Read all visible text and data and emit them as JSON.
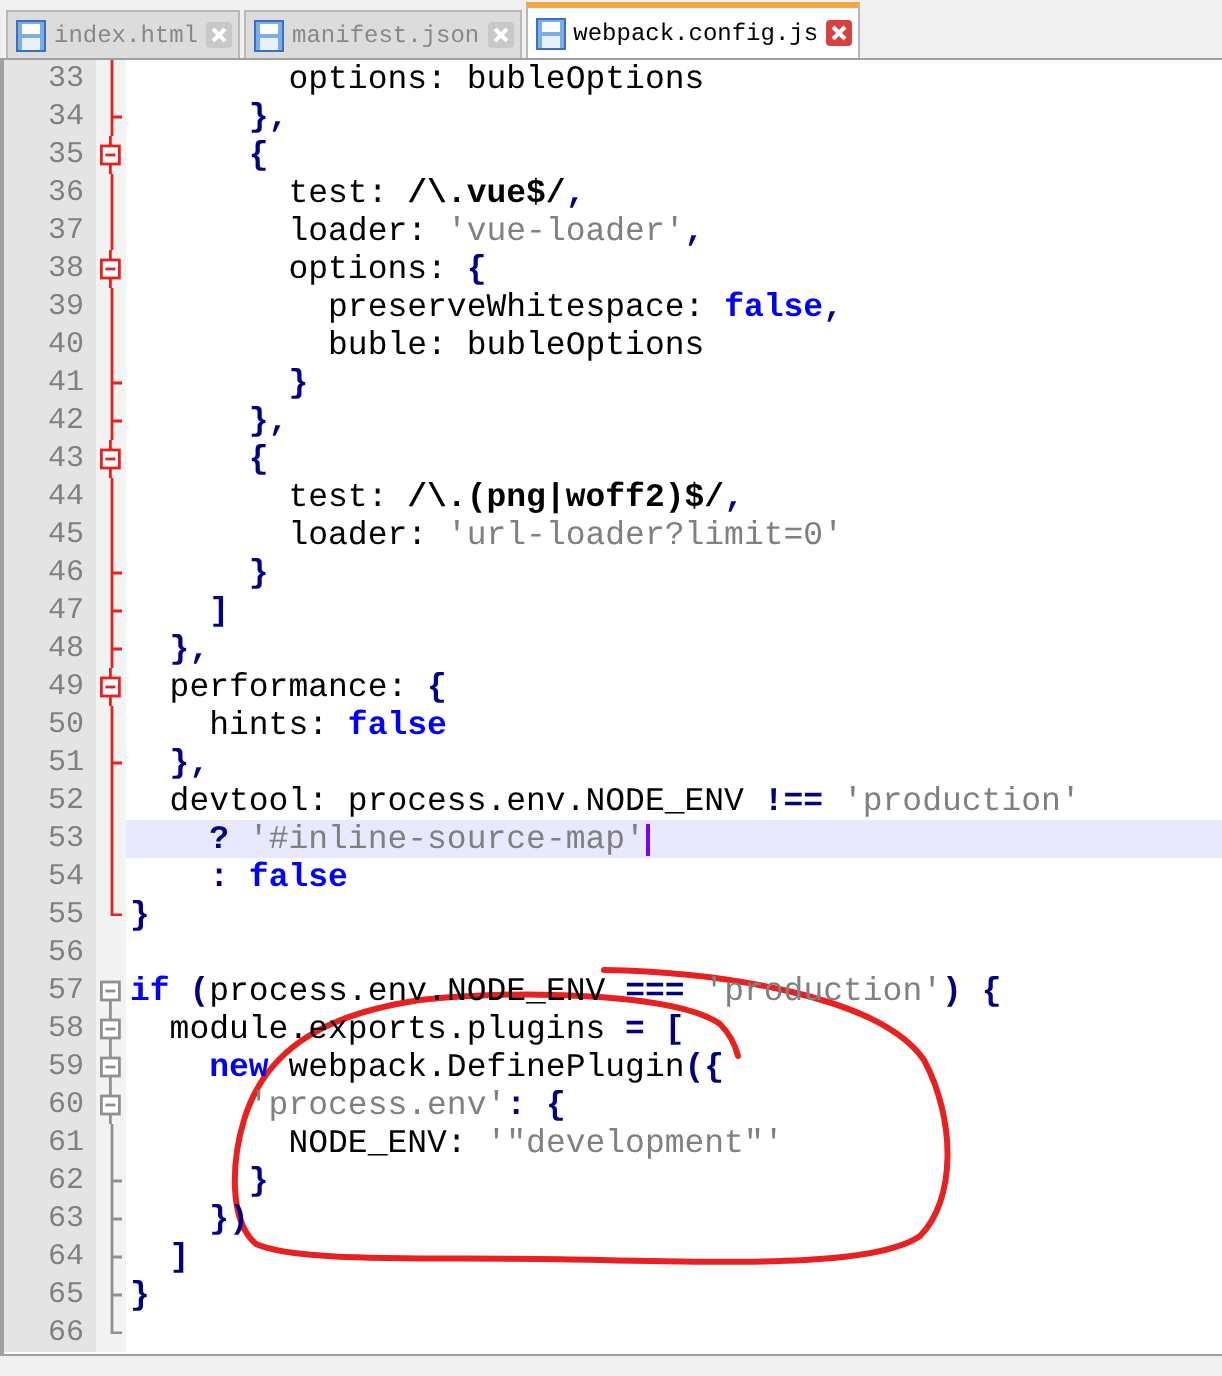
{
  "tabs": [
    {
      "label": "index.html",
      "selected": false
    },
    {
      "label": "manifest.json",
      "selected": false
    },
    {
      "label": "webpack.config.js",
      "selected": true
    }
  ],
  "editor": {
    "lines": [
      {
        "number": "33",
        "fold": {
          "kind": "body",
          "highlight": true
        },
        "current": false,
        "tokens": [
          {
            "text": "        options: bubleOptions",
            "kind": "id"
          }
        ]
      },
      {
        "number": "34",
        "fold": {
          "kind": "end",
          "highlight": true
        },
        "current": false,
        "tokens": [
          {
            "text": "      },",
            "kind": "op"
          }
        ]
      },
      {
        "number": "35",
        "fold": {
          "kind": "start",
          "highlight": true
        },
        "current": false,
        "tokens": [
          {
            "text": "      {",
            "kind": "op"
          }
        ]
      },
      {
        "number": "36",
        "fold": {
          "kind": "body",
          "highlight": true
        },
        "current": false,
        "tokens": [
          {
            "text": "        test: ",
            "kind": "id"
          },
          {
            "text": "/\\.vue$/",
            "kind": "re"
          },
          {
            "text": ",",
            "kind": "op"
          }
        ]
      },
      {
        "number": "37",
        "fold": {
          "kind": "body",
          "highlight": true
        },
        "current": false,
        "tokens": [
          {
            "text": "        loader: ",
            "kind": "id"
          },
          {
            "text": "'vue-loader'",
            "kind": "str"
          },
          {
            "text": ",",
            "kind": "op"
          }
        ]
      },
      {
        "number": "38",
        "fold": {
          "kind": "start",
          "highlight": true
        },
        "current": false,
        "tokens": [
          {
            "text": "        options: ",
            "kind": "id"
          },
          {
            "text": "{",
            "kind": "op"
          }
        ]
      },
      {
        "number": "39",
        "fold": {
          "kind": "body",
          "highlight": true
        },
        "current": false,
        "tokens": [
          {
            "text": "          preserveWhitespace: ",
            "kind": "id"
          },
          {
            "text": "false",
            "kind": "kw"
          },
          {
            "text": ",",
            "kind": "op"
          }
        ]
      },
      {
        "number": "40",
        "fold": {
          "kind": "body",
          "highlight": true
        },
        "current": false,
        "tokens": [
          {
            "text": "          buble: bubleOptions",
            "kind": "id"
          }
        ]
      },
      {
        "number": "41",
        "fold": {
          "kind": "end",
          "highlight": true
        },
        "current": false,
        "tokens": [
          {
            "text": "        }",
            "kind": "op"
          }
        ]
      },
      {
        "number": "42",
        "fold": {
          "kind": "end",
          "highlight": true
        },
        "current": false,
        "tokens": [
          {
            "text": "      },",
            "kind": "op"
          }
        ]
      },
      {
        "number": "43",
        "fold": {
          "kind": "start",
          "highlight": true
        },
        "current": false,
        "tokens": [
          {
            "text": "      {",
            "kind": "op"
          }
        ]
      },
      {
        "number": "44",
        "fold": {
          "kind": "body",
          "highlight": true
        },
        "current": false,
        "tokens": [
          {
            "text": "        test: ",
            "kind": "id"
          },
          {
            "text": "/\\.(png|woff2)$/",
            "kind": "re"
          },
          {
            "text": ",",
            "kind": "op"
          }
        ]
      },
      {
        "number": "45",
        "fold": {
          "kind": "body",
          "highlight": true
        },
        "current": false,
        "tokens": [
          {
            "text": "        loader: ",
            "kind": "id"
          },
          {
            "text": "'url-loader?limit=0'",
            "kind": "str"
          }
        ]
      },
      {
        "number": "46",
        "fold": {
          "kind": "end",
          "highlight": true
        },
        "current": false,
        "tokens": [
          {
            "text": "      }",
            "kind": "op"
          }
        ]
      },
      {
        "number": "47",
        "fold": {
          "kind": "end",
          "highlight": true
        },
        "current": false,
        "tokens": [
          {
            "text": "    ]",
            "kind": "op"
          }
        ]
      },
      {
        "number": "48",
        "fold": {
          "kind": "end",
          "highlight": true
        },
        "current": false,
        "tokens": [
          {
            "text": "  },",
            "kind": "op"
          }
        ]
      },
      {
        "number": "49",
        "fold": {
          "kind": "start",
          "highlight": true
        },
        "current": false,
        "tokens": [
          {
            "text": "  performance: ",
            "kind": "id"
          },
          {
            "text": "{",
            "kind": "op"
          }
        ]
      },
      {
        "number": "50",
        "fold": {
          "kind": "body",
          "highlight": true
        },
        "current": false,
        "tokens": [
          {
            "text": "    hints: ",
            "kind": "id"
          },
          {
            "text": "false",
            "kind": "kw"
          }
        ]
      },
      {
        "number": "51",
        "fold": {
          "kind": "end",
          "highlight": true
        },
        "current": false,
        "tokens": [
          {
            "text": "  },",
            "kind": "op"
          }
        ]
      },
      {
        "number": "52",
        "fold": {
          "kind": "body",
          "highlight": true
        },
        "current": false,
        "tokens": [
          {
            "text": "  devtool: process.env.NODE_ENV ",
            "kind": "id"
          },
          {
            "text": "!==",
            "kind": "op"
          },
          {
            "text": " 'production'",
            "kind": "str"
          }
        ]
      },
      {
        "number": "53",
        "fold": {
          "kind": "body",
          "highlight": true
        },
        "current": true,
        "tokens": [
          {
            "text": "    ?",
            "kind": "op"
          },
          {
            "text": " '#inline-source-map'",
            "kind": "str"
          }
        ]
      },
      {
        "number": "54",
        "fold": {
          "kind": "body",
          "highlight": true
        },
        "current": false,
        "tokens": [
          {
            "text": "    :",
            "kind": "op"
          },
          {
            "text": " false",
            "kind": "kw"
          }
        ]
      },
      {
        "number": "55",
        "fold": {
          "kind": "last",
          "highlight": true
        },
        "current": false,
        "tokens": [
          {
            "text": "}",
            "kind": "op"
          }
        ]
      },
      {
        "number": "56",
        "current": false
      },
      {
        "number": "57",
        "fold": {
          "kind": "top",
          "highlight": false
        },
        "current": false,
        "tokens": [
          {
            "text": "if",
            "kind": "kw"
          },
          {
            "text": " (",
            "kind": "op"
          },
          {
            "text": "process.env.NODE_ENV ",
            "kind": "id"
          },
          {
            "text": "===",
            "kind": "op"
          },
          {
            "text": " 'production'",
            "kind": "str"
          },
          {
            "text": ") {",
            "kind": "op"
          }
        ]
      },
      {
        "number": "58",
        "fold": {
          "kind": "start",
          "highlight": false
        },
        "current": false,
        "tokens": [
          {
            "text": "  module.exports.plugins ",
            "kind": "id"
          },
          {
            "text": "= [",
            "kind": "op"
          }
        ]
      },
      {
        "number": "59",
        "fold": {
          "kind": "start",
          "highlight": false
        },
        "current": false,
        "tokens": [
          {
            "text": "    new",
            "kind": "kw"
          },
          {
            "text": " webpack.DefinePlugin",
            "kind": "id"
          },
          {
            "text": "({",
            "kind": "op"
          }
        ]
      },
      {
        "number": "60",
        "fold": {
          "kind": "start",
          "highlight": false
        },
        "current": false,
        "tokens": [
          {
            "text": "      'process.env'",
            "kind": "str"
          },
          {
            "text": ": {",
            "kind": "op"
          }
        ]
      },
      {
        "number": "61",
        "fold": {
          "kind": "body",
          "highlight": false
        },
        "current": false,
        "tokens": [
          {
            "text": "        NODE_ENV: ",
            "kind": "id"
          },
          {
            "text": "'\"development\"'",
            "kind": "str"
          }
        ]
      },
      {
        "number": "62",
        "fold": {
          "kind": "end",
          "highlight": false
        },
        "current": false,
        "tokens": [
          {
            "text": "      }",
            "kind": "op"
          }
        ]
      },
      {
        "number": "63",
        "fold": {
          "kind": "end",
          "highlight": false
        },
        "current": false,
        "tokens": [
          {
            "text": "    })",
            "kind": "op"
          }
        ]
      },
      {
        "number": "64",
        "fold": {
          "kind": "end",
          "highlight": false
        },
        "current": false,
        "tokens": [
          {
            "text": "  ]",
            "kind": "op"
          }
        ]
      },
      {
        "number": "65",
        "fold": {
          "kind": "end",
          "highlight": false
        },
        "current": false,
        "tokens": [
          {
            "text": "}",
            "kind": "op"
          }
        ]
      },
      {
        "number": "66",
        "fold": {
          "kind": "last",
          "highlight": false
        },
        "current": false
      }
    ]
  },
  "annotation": {
    "kind": "freehand-circle"
  }
}
